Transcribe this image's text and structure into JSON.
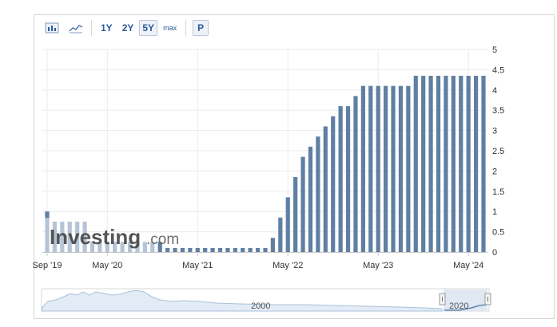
{
  "toolbar": {
    "range_buttons": [
      "1Y",
      "2Y",
      "5Y",
      "max"
    ],
    "active_range": "5Y",
    "p_button": "P"
  },
  "watermark": {
    "brand": "Investing",
    "suffix": ".com"
  },
  "colors": {
    "bar": "#5f7fa3",
    "bar_faded": "#b5c4d6",
    "grid": "#ebebeb",
    "accent": "#2a5a9e"
  },
  "navigator": {
    "labels": [
      "2000",
      "2020"
    ]
  },
  "chart_data": {
    "type": "bar",
    "title": "",
    "xlabel": "",
    "ylabel": "",
    "ylim": [
      0,
      5
    ],
    "yticks": [
      "0",
      "0.5",
      "1",
      "1.5",
      "2",
      "2.5",
      "3",
      "3.5",
      "4",
      "4.5",
      "5"
    ],
    "y_axis_side": "right",
    "grid": true,
    "xtick_labels": [
      "Sep '19",
      "May '20",
      "May '21",
      "May '22",
      "May '23",
      "May '24"
    ],
    "categories": [
      "Sep 2019",
      "Oct 2019",
      "Nov 2019",
      "Dec 2019",
      "Jan 2020",
      "Feb 2020",
      "Mar 2020",
      "Apr 2020",
      "May 2020",
      "Jun 2020",
      "Jul 2020",
      "Aug 2020",
      "Sep 2020",
      "Oct 2020",
      "Nov 2020",
      "Dec 2020",
      "Jan 2021",
      "Feb 2021",
      "Mar 2021",
      "Apr 2021",
      "May 2021",
      "Jun 2021",
      "Jul 2021",
      "Aug 2021",
      "Sep 2021",
      "Oct 2021",
      "Nov 2021",
      "Dec 2021",
      "Jan 2022",
      "Feb 2022",
      "Mar 2022",
      "Apr 2022",
      "May 2022",
      "Jun 2022",
      "Jul 2022",
      "Aug 2022",
      "Sep 2022",
      "Oct 2022",
      "Nov 2022",
      "Dec 2022",
      "Jan 2023",
      "Feb 2023",
      "Mar 2023",
      "Apr 2023",
      "May 2023",
      "Jun 2023",
      "Jul 2023",
      "Aug 2023",
      "Sep 2023",
      "Oct 2023",
      "Nov 2023",
      "Dec 2023",
      "Jan 2024",
      "Feb 2024",
      "Mar 2024",
      "Apr 2024",
      "May 2024",
      "Jun 2024",
      "Jul 2024"
    ],
    "values": [
      1.0,
      0.75,
      0.75,
      0.75,
      0.75,
      0.75,
      0.25,
      0.25,
      0.25,
      0.25,
      0.25,
      0.25,
      0.25,
      0.25,
      0.25,
      0.25,
      0.1,
      0.1,
      0.1,
      0.1,
      0.1,
      0.1,
      0.1,
      0.1,
      0.1,
      0.1,
      0.1,
      0.1,
      0.1,
      0.1,
      0.35,
      0.85,
      1.35,
      1.85,
      2.35,
      2.6,
      2.85,
      3.1,
      3.35,
      3.6,
      3.6,
      3.85,
      4.1,
      4.1,
      4.1,
      4.1,
      4.1,
      4.1,
      4.1,
      4.35,
      4.35,
      4.35,
      4.35,
      4.35,
      4.35,
      4.35,
      4.35,
      4.35,
      4.35
    ]
  }
}
